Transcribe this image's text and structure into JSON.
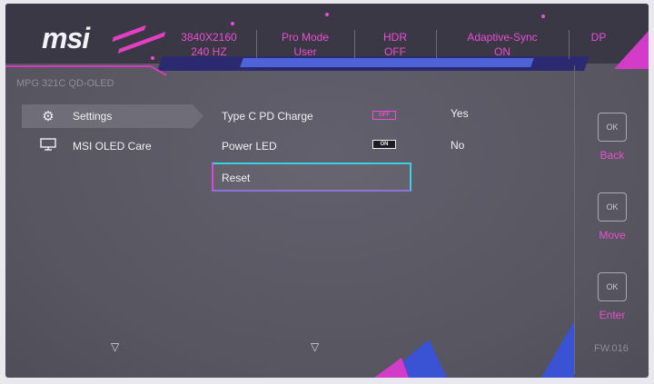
{
  "brand": "msi",
  "model": "MPG 321C QD-OLED",
  "status": [
    {
      "line1": "3840X2160",
      "line2": "240 HZ"
    },
    {
      "line1": "Pro Mode",
      "line2": "User"
    },
    {
      "line1": "HDR",
      "line2": "OFF"
    },
    {
      "line1": "Adaptive-Sync",
      "line2": "ON"
    },
    {
      "line1": "DP",
      "line2": ""
    }
  ],
  "menu": [
    {
      "label": "Settings",
      "icon": "gear-icon",
      "active": true
    },
    {
      "label": "MSI OLED Care",
      "icon": "monitor-icon",
      "active": false
    }
  ],
  "submenu": [
    {
      "label": "Type C PD Charge",
      "toggle": "OFF",
      "value": "Yes"
    },
    {
      "label": "Power LED",
      "toggle": "ON",
      "value": "No"
    },
    {
      "label": "Reset",
      "selected": true
    }
  ],
  "nav": [
    {
      "label": "Back",
      "glyph": "OK"
    },
    {
      "label": "Move",
      "glyph": "OK"
    },
    {
      "label": "Enter",
      "glyph": "OK"
    }
  ],
  "firmware": "FW.016",
  "colors": {
    "accent": "#ea4ed5",
    "highlight": "#39d1e4",
    "background": "#5a5864"
  }
}
